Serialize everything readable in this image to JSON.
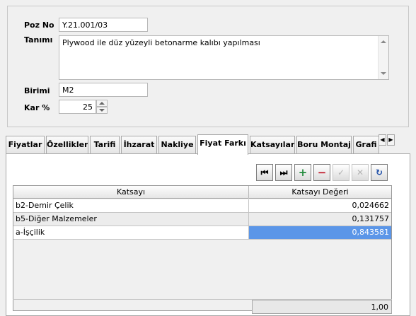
{
  "form": {
    "poz_no_label": "Poz No",
    "poz_no_value": "Y.21.001/03",
    "tanimi_label": "Tanımı",
    "tanimi_value": "Plywood ile düz yüzeyli betonarme kalıbı yapılması",
    "birimi_label": "Birimi",
    "birimi_value": "M2",
    "kar_label": "Kar %",
    "kar_value": "25"
  },
  "tabs": [
    {
      "label": "Fiyatlar",
      "active": false
    },
    {
      "label": "Özellikler",
      "active": false
    },
    {
      "label": "Tarifi",
      "active": false
    },
    {
      "label": "İhzarat",
      "active": false
    },
    {
      "label": "Nakliye",
      "active": false
    },
    {
      "label": "Fiyat Farkı",
      "active": true
    },
    {
      "label": "Katsayılar",
      "active": false
    },
    {
      "label": "Boru Montaj",
      "active": false
    },
    {
      "label": "Grafi",
      "active": false
    }
  ],
  "toolbar": {
    "first_icon": "first-record-icon",
    "last_icon": "last-record-icon",
    "add_icon": "add-record-icon",
    "delete_icon": "delete-record-icon",
    "post_icon": "post-icon",
    "cancel_icon": "cancel-icon",
    "refresh_icon": "refresh-icon"
  },
  "grid": {
    "columns": [
      "Katsayı",
      "Katsayı Değeri"
    ],
    "rows": [
      {
        "name": "b2-Demir Çelik",
        "value": "0,024662"
      },
      {
        "name": "b5-Diğer Malzemeler",
        "value": "0,131757"
      },
      {
        "name": "a-İşçilik",
        "value": "0,843581"
      }
    ],
    "footer_total": "1,00"
  },
  "colors": {
    "selection": "#5b96e8",
    "window_bg": "#f0f0f0",
    "add_green": "#1f8a3b",
    "delete_red": "#c0182a"
  }
}
